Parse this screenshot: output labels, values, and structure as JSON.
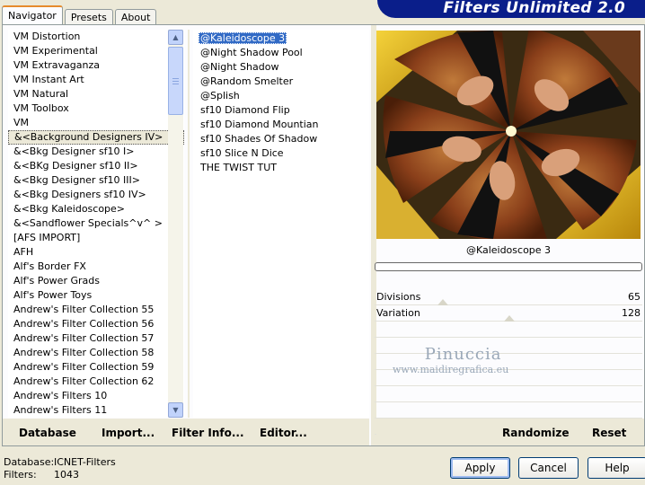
{
  "tabs": [
    {
      "label": "Navigator",
      "active": true
    },
    {
      "label": "Presets",
      "active": false
    },
    {
      "label": "About",
      "active": false
    }
  ],
  "banner": {
    "title": "Filters Unlimited 2.0"
  },
  "categories": [
    "VM Distortion",
    "VM Experimental",
    "VM Extravaganza",
    "VM Instant Art",
    "VM Natural",
    "VM Toolbox",
    "VM",
    "&<Background Designers IV>",
    "&<Bkg Designer sf10 I>",
    "&<BKg Designer sf10 II>",
    "&<Bkg Designer sf10 III>",
    "&<Bkg Designers sf10 IV>",
    "&<Bkg Kaleidoscope>",
    "&<Sandflower Specials^v^ >",
    "[AFS IMPORT]",
    "AFH",
    "Alf's Border FX",
    "Alf's Power Grads",
    "Alf's Power Toys",
    "Andrew's Filter Collection 55",
    "Andrew's Filter Collection 56",
    "Andrew's Filter Collection 57",
    "Andrew's Filter Collection 58",
    "Andrew's Filter Collection 59",
    "Andrew's Filter Collection 62",
    "Andrew's Filters 10",
    "Andrew's Filters 11"
  ],
  "selected_category_index": 7,
  "effects": [
    "@Kaleidoscope 3",
    "@Night Shadow Pool",
    "@Night Shadow",
    "@Random Smelter",
    "@Splish",
    "sf10 Diamond Flip",
    "sf10 Diamond Mountian",
    "sf10 Shades Of Shadow",
    "sf10 Slice N Dice",
    "THE TWIST TUT"
  ],
  "selected_effect_index": 0,
  "preview": {
    "caption": "@Kaleidoscope 3"
  },
  "params": [
    {
      "label": "Divisions",
      "value": "65"
    },
    {
      "label": "Variation",
      "value": "128"
    }
  ],
  "watermark": {
    "title": "Pinuccia",
    "url": "www.maidiregrafica.eu"
  },
  "toolbar": {
    "database": "Database",
    "import": "Import...",
    "filter_info": "Filter Info...",
    "editor": "Editor...",
    "randomize": "Randomize",
    "reset": "Reset"
  },
  "status": {
    "database_key": "Database:",
    "database_value": "ICNET-Filters",
    "filters_key": "Filters:",
    "filters_value": "1043"
  },
  "buttons": {
    "apply": "Apply",
    "cancel": "Cancel",
    "help": "Help"
  }
}
